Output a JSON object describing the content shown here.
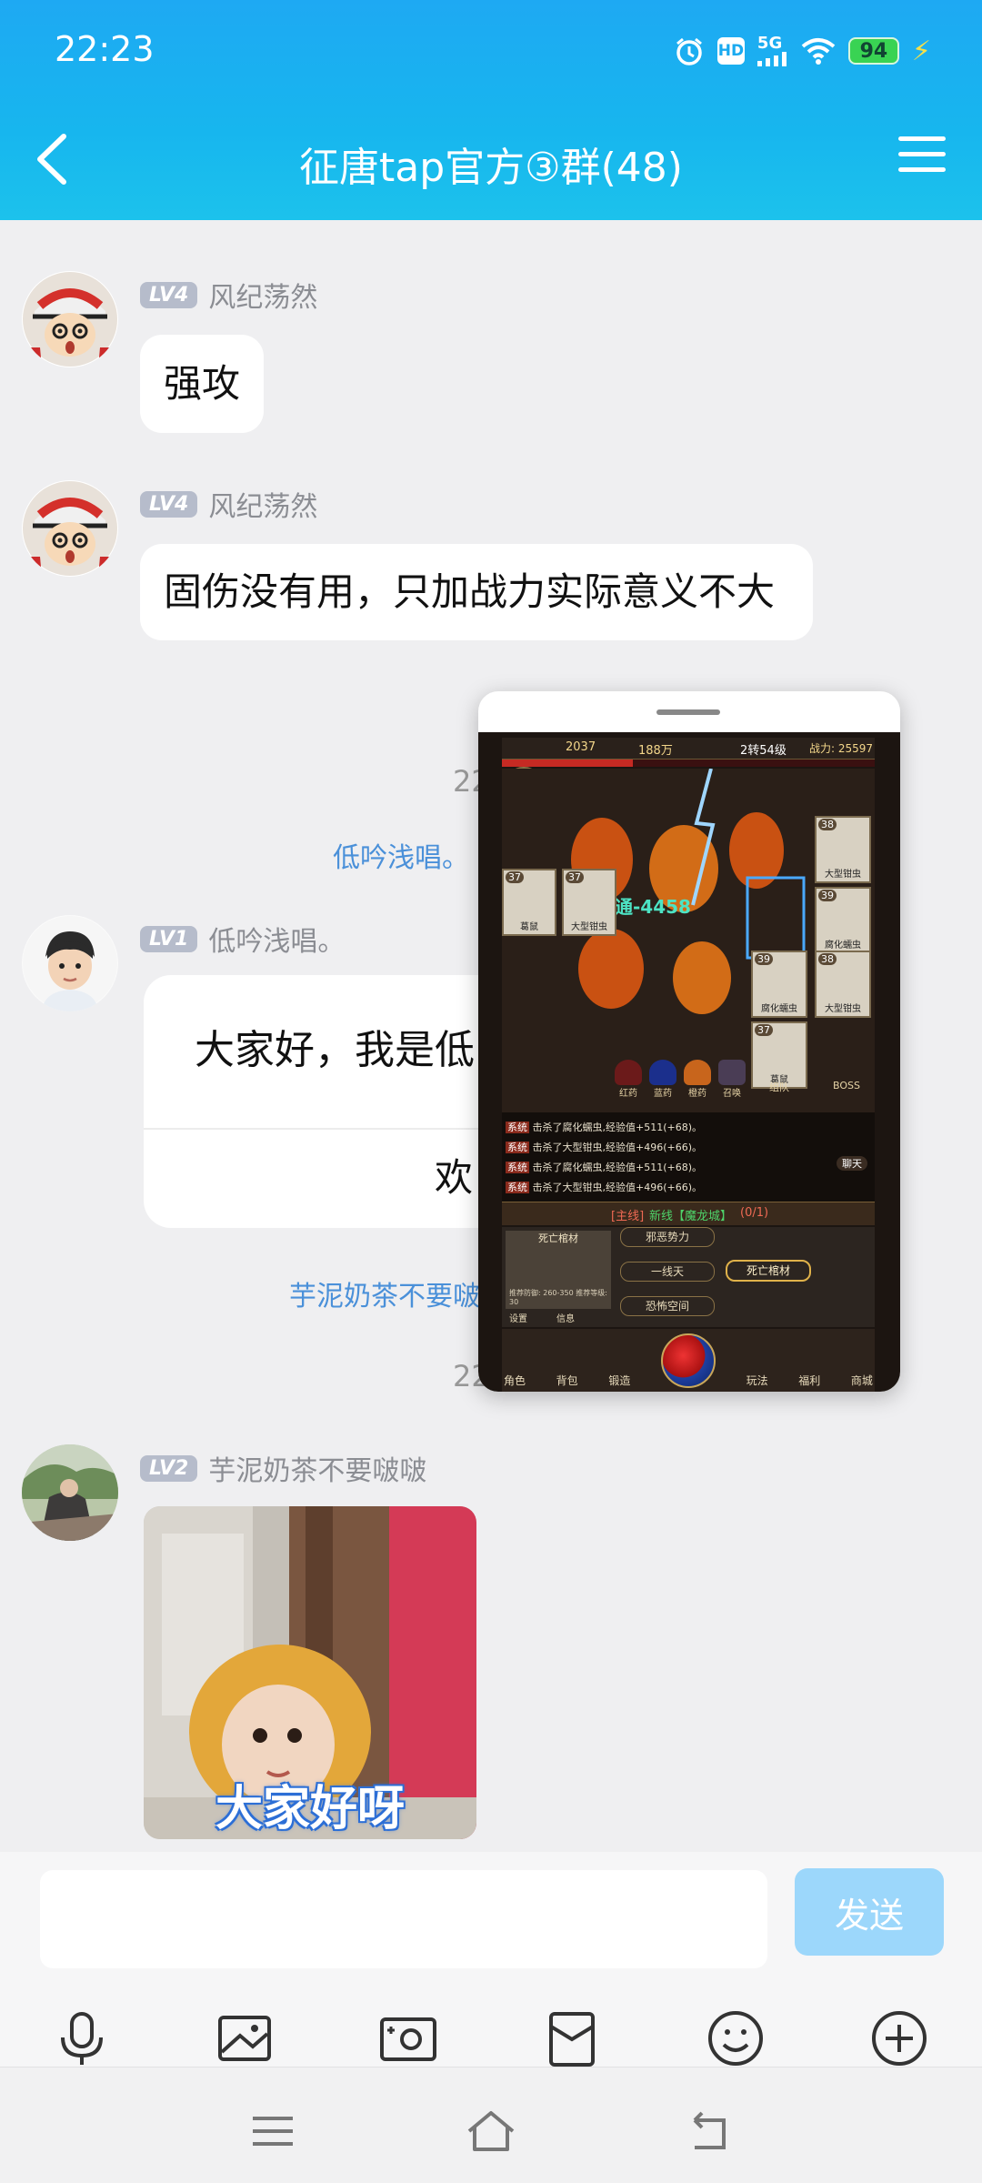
{
  "status_bar": {
    "time": "22:23",
    "hd": "HD",
    "network": "5G",
    "battery": "94"
  },
  "header": {
    "title": "征唐tap官方③群(48)"
  },
  "messages": [
    {
      "level": "LV4",
      "sender": "风纪荡然",
      "text": "强攻"
    },
    {
      "level": "LV4",
      "sender": "风纪荡然",
      "text": "固伤没有用，只加战力实际意义不大"
    },
    {
      "time": "22"
    },
    {
      "note": "低吟浅唱。"
    },
    {
      "level": "LV1",
      "sender": "低吟浅唱。",
      "card_text": "大家好，我是低",
      "card_action": "欢"
    },
    {
      "note": "芋泥奶茶不要啵"
    },
    {
      "time": "22"
    },
    {
      "level": "LV2",
      "sender": "芋泥奶茶不要啵啵",
      "sticker_caption": "大家好呀"
    }
  ],
  "game_window": {
    "gold": "2037",
    "money": "188万",
    "stage": "2转54级",
    "power": "战力: 25597",
    "enemy_cards": [
      {
        "level": "37",
        "name": "葛鼠"
      },
      {
        "level": "37",
        "name": "大型钳虫"
      },
      {
        "level": "38",
        "name": "大型钳虫"
      },
      {
        "level": "39",
        "name": "腐化蠕虫"
      },
      {
        "level": "39",
        "name": "腐化蠕虫"
      },
      {
        "level": "38",
        "name": "大型钳虫"
      },
      {
        "level": "37",
        "name": "葛鼠"
      }
    ],
    "damage_text": "普通-4458",
    "potions": [
      "红药",
      "蓝药",
      "橙药",
      "召唤"
    ],
    "party_btn": "组队",
    "boss_btn": "BOSS",
    "battle_log": [
      "击杀了腐化蠕虫,经验值+511(+68)。",
      "击杀了大型钳虫,经验值+496(+66)。",
      "击杀了腐化蠕虫,经验值+511(+68)。",
      "击杀了大型钳虫,经验值+496(+66)。"
    ],
    "log_tag": "系统",
    "chat_btn": "聊天",
    "quest_tag": "[主线]",
    "quest_text": "新线【魔龙城】",
    "quest_progress": "(0/1)",
    "map_name": "死亡棺材",
    "map_info": "推荐防御: 260-350 推荐等级: 30",
    "map_nodes": [
      "邪恶势力",
      "一线天",
      "死亡棺材",
      "恐怖空间"
    ],
    "settings_btn": "设置",
    "info_btn": "信息",
    "bottom_tabs": [
      "角色",
      "背包",
      "锻造",
      "玩法",
      "福利",
      "商城"
    ]
  },
  "input": {
    "placeholder": "",
    "send_label": "发送"
  },
  "toolbar": [
    "mic-icon",
    "image-icon",
    "camera-icon",
    "red-packet-icon",
    "emoji-icon",
    "plus-icon"
  ],
  "nav": [
    "menu-icon",
    "home-icon",
    "back-icon"
  ]
}
